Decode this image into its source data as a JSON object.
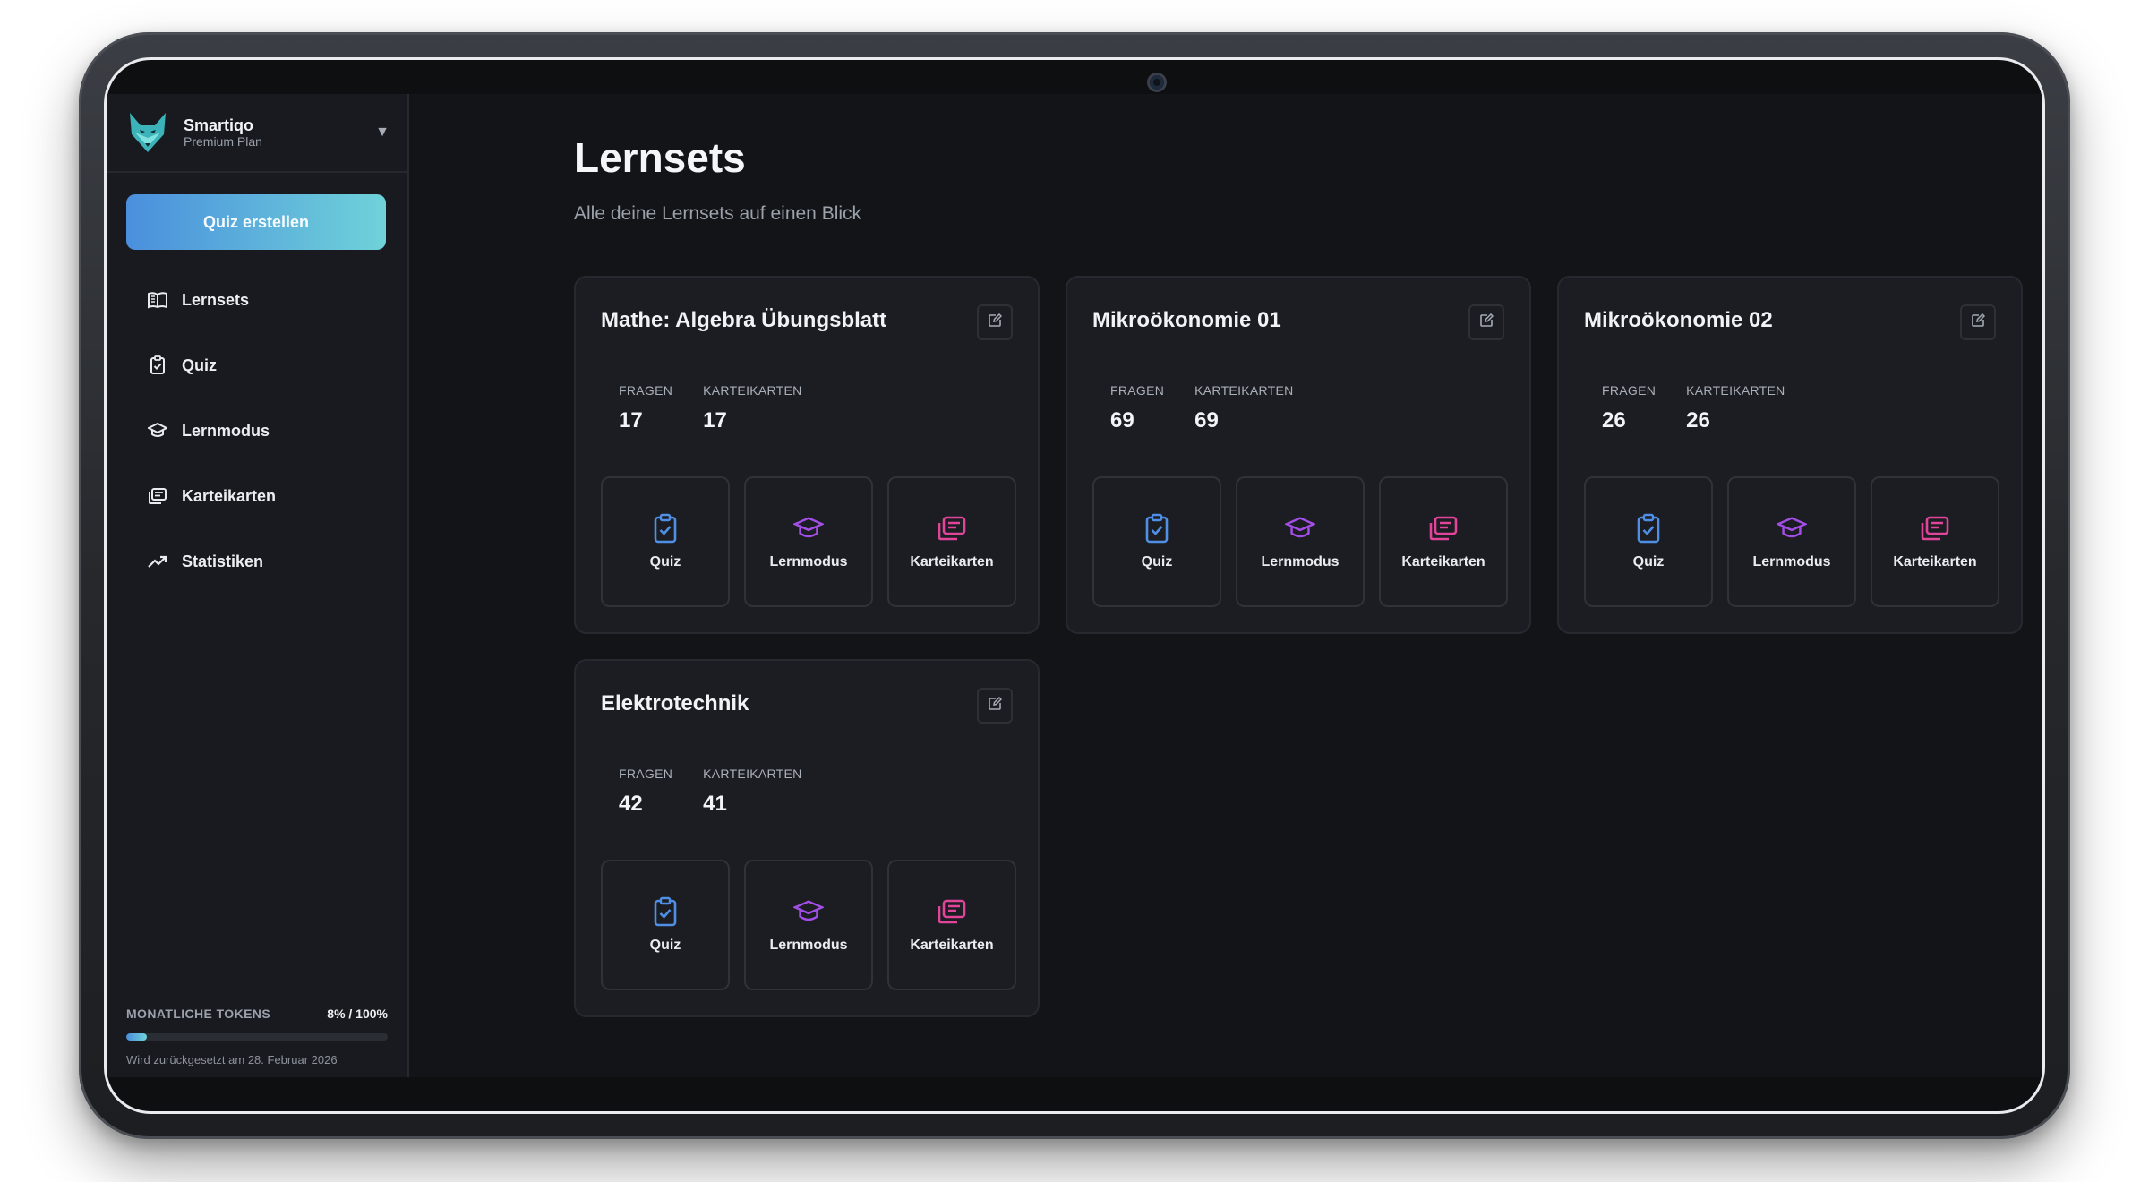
{
  "brand": {
    "name": "Smartiqo",
    "plan": "Premium Plan"
  },
  "sidebar": {
    "create_button": "Quiz erstellen",
    "items": [
      {
        "label": "Lernsets",
        "icon": "book-open-icon"
      },
      {
        "label": "Quiz",
        "icon": "clipboard-check-icon"
      },
      {
        "label": "Lernmodus",
        "icon": "graduation-cap-icon"
      },
      {
        "label": "Karteikarten",
        "icon": "cards-icon"
      },
      {
        "label": "Statistiken",
        "icon": "trending-up-icon"
      }
    ],
    "tokens": {
      "label": "MONATLICHE TOKENS",
      "value": "8% / 100%",
      "progress": 0.08,
      "reset_text": "Wird zurückgesetzt am 28. Februar 2026"
    }
  },
  "main": {
    "title": "Lernsets",
    "subtitle": "Alle deine Lernsets auf einen Blick",
    "stat_labels": {
      "questions": "FRAGEN",
      "cards": "KARTEIKARTEN"
    },
    "action_labels": {
      "quiz": "Quiz",
      "learn": "Lernmodus",
      "cards": "Karteikarten"
    },
    "sets": [
      {
        "title": "Mathe: Algebra Übungsblatt",
        "questions": "17",
        "cards": "17"
      },
      {
        "title": "Mikroökonomie 01",
        "questions": "69",
        "cards": "69"
      },
      {
        "title": "Mikroökonomie 02",
        "questions": "26",
        "cards": "26"
      },
      {
        "title": "Elektrotechnik",
        "questions": "42",
        "cards": "41"
      }
    ]
  },
  "colors": {
    "accent_start": "#4a8fdd",
    "accent_end": "#6fd2d9",
    "quiz_icon": "#4f8fe6",
    "learn_icon": "#a34ee6",
    "cards_icon": "#e0459a"
  }
}
